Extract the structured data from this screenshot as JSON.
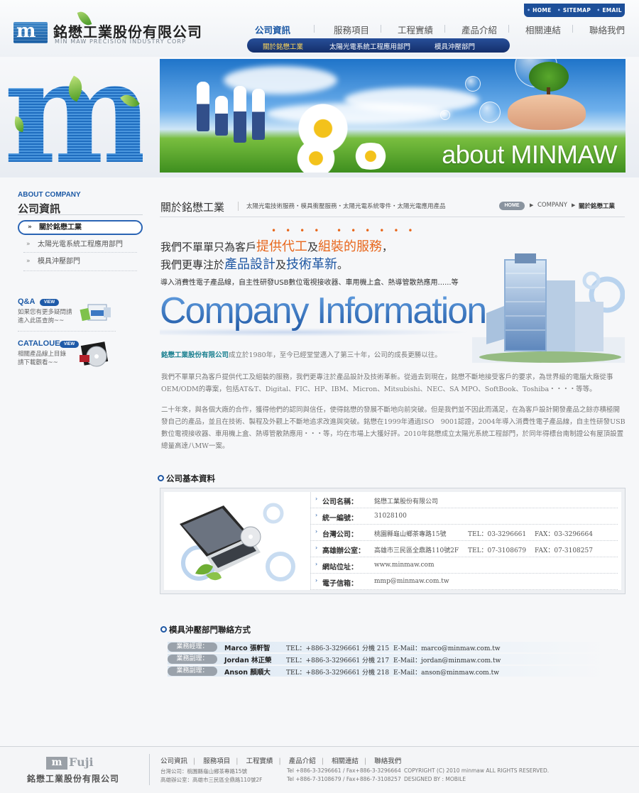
{
  "header": {
    "logo_mark": "m",
    "company_name": "銘懋工業股份有限公司",
    "company_en": "MIN MAW PRECISION INDUSTRY CORP",
    "toplinks": [
      "HOME",
      "SITEMAP",
      "EMAIL"
    ],
    "nav": [
      "公司資訊",
      "服務項目",
      "工程實績",
      "產品介紹",
      "相關連結",
      "聯絡我們"
    ],
    "subnav": [
      "關於銘懋工業",
      "太陽光電系統工程應用部門",
      "模具沖壓部門"
    ]
  },
  "banner": {
    "big_letter": "m",
    "about_text": "about MINMAW"
  },
  "sidebar": {
    "en_title": "ABOUT COMPANY",
    "title": "公司資訊",
    "items": [
      "關於銘懋工業",
      "太陽光電系統工程應用部門",
      "模具沖壓部門"
    ],
    "qa": {
      "title": "Q&A",
      "badge": "VIEW",
      "line1": "如果您有更多疑問請",
      "line2": "進入此區查詢~~"
    },
    "catalogue": {
      "title": "CATALOUE",
      "badge": "VIEW",
      "line1": "相關產品線上目錄",
      "line2": "請下載觀看~~"
    }
  },
  "content": {
    "title": "關於銘懋工業",
    "subtitle": "太陽光電技術服務・模具衝壓服務・太陽光電系統零件・太陽光電應用產品",
    "breadcrumb": {
      "home": "HOME",
      "section": "COMPANY",
      "current": "關於銘懋工業"
    },
    "slogan": {
      "l1_a": "我們不單單只為客戶",
      "l1_b": "提供代工",
      "l1_c": "及",
      "l1_d": "組裝的服務",
      "l1_e": "，",
      "l2_a": "我們更專注於",
      "l2_b": "產品設計",
      "l2_c": "及",
      "l2_d": "技術革新",
      "l2_e": "。",
      "l3": "導入消費性電子產品線，自主性研發USB數位電視接收器、車用機上盒、熱導管散熱應用......等"
    },
    "company_info": "Company Information",
    "para1_company": "銘懋工業股份有限公司",
    "para1_rest": "成立於1980年，至今已經堂堂邁入了第三十年，公司的成長更勝以往。",
    "para2": "我們不單單只為客戶提供代工及組裝的服務，我們更專注於產品設計及技術革新。從過去到現在，銘懋不斷地接受客戶的要求，為世界級的電腦大廠從事OEM/ODM的專案，包括AT&T、Digital、FIC、HP、IBM、Micron、Mitsubishi、NEC、SA MPO、SoftBook、Toshiba・・・・等等。",
    "para3": "二十年來，與各個大廠的合作，獲得他們的認同與信任，使得銘懋的發展不斷地向前突破。但是我們並不因此而滿足，在為客戶設計開發產品之餘亦積極開發自己的產品，並且在技術、製程及外觀上不斷地追求改進與突破。銘懋在1999年通過ISO　9001認證，2004年導入消費性電子產品線，自主性研發USB數位電視接收器、車用機上盒、熱導管散熱應用・・・等，均在市場上大獲好評。2010年銘懋成立太陽光系統工程部門，於同年得標台南制證公有屋頂設置總量高達八MW一案。"
  },
  "basic_info": {
    "title": "公司基本資料",
    "rows": [
      {
        "label": "公司名稱：",
        "value": "銘懋工業股份有限公司",
        "tel": "",
        "fax": ""
      },
      {
        "label": "統一編號：",
        "value": "31028100",
        "tel": "",
        "fax": ""
      },
      {
        "label": "台灣公司：",
        "value": "桃園縣龜山鄉茶專路15號",
        "tel": "TEL：03-3296661",
        "fax": "FAX：03-3296664"
      },
      {
        "label": "高雄辦公室：",
        "value": "高雄市三民區全鼎路110號2F",
        "tel": "TEL：07-3108679",
        "fax": "FAX：07-3108257"
      },
      {
        "label": "網站位址：",
        "value": "www.minmaw.com",
        "tel": "",
        "fax": ""
      },
      {
        "label": "電子信箱：",
        "value": "mmp@minmaw.com.tw",
        "tel": "",
        "fax": ""
      }
    ]
  },
  "contacts": {
    "title": "模具沖壓部門聯絡方式",
    "rows": [
      {
        "role": "業務經理：",
        "name": "Marco 張軒智",
        "tel": "TEL：+886-3-3296661 分機 215",
        "mail": "E-Mail：marco@minmaw.com.tw"
      },
      {
        "role": "業務副理：",
        "name": "Jordan 林正榮",
        "tel": "TEL：+886-3-3296661 分機 217",
        "mail": "E-Mail：jordan@minmaw.com.tw"
      },
      {
        "role": "業務副理：",
        "name": "Anson 顏順大",
        "tel": "TEL：+886-3-3296661 分機 218",
        "mail": "E-Mail：anson@minmaw.com.tw"
      }
    ]
  },
  "footer": {
    "logo_mark": "m",
    "logo_text": "Fuji",
    "company": "銘懋工業股份有限公司",
    "nav": [
      "公司資訊",
      "服務項目",
      "工程實績",
      "產品介紹",
      "相關連結",
      "聯絡我們"
    ],
    "addr1": "台灣公司：桃園縣龜山鄉茶專路15號",
    "addr2": "高雄辦公室：高雄市三民區全鼎路110號2F",
    "tel1": "Tel +886-3-3296661 / Fax+886-3-3296664",
    "tel2": "Tel +886-7-3108679 / Fax+886-7-3108257",
    "copyright": "COPYRIGHT (C) 2010 minmaw ALL RIGHTS RESERVED.",
    "designed_by": "DESIGNED BY : MOBILE"
  },
  "colors": {
    "brand_blue": "#1d56a3",
    "highlight_orange": "#e8671c",
    "nav_dark": "#1d4f99"
  }
}
